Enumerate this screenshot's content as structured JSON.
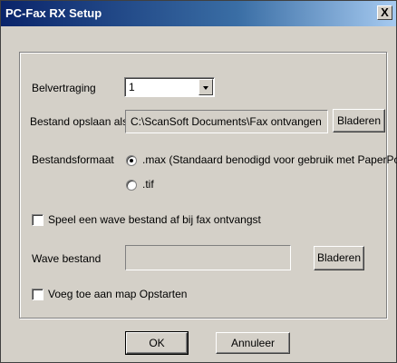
{
  "window": {
    "title": "PC-Fax RX Setup",
    "close_glyph": "X"
  },
  "belvertraging": {
    "label": "Belvertraging",
    "value": "1"
  },
  "bestand_opslaan": {
    "label": "Bestand opslaan als",
    "path": "C:\\ScanSoft Documents\\Fax ontvangen",
    "browse_label": "Bladeren"
  },
  "bestandsformaat": {
    "label": "Bestandsformaat",
    "options": [
      {
        "label": ".max (Standaard benodigd voor gebruik met PaperPort)",
        "selected": true
      },
      {
        "label": ".tif",
        "selected": false
      }
    ]
  },
  "wave_checkbox": {
    "label": "Speel een wave bestand af bij fax ontvangst",
    "checked": false
  },
  "wave_bestand": {
    "label": "Wave bestand",
    "path": "",
    "browse_label": "Bladeren"
  },
  "startup_checkbox": {
    "label": "Voeg toe aan map Opstarten",
    "checked": false
  },
  "buttons": {
    "ok": "OK",
    "cancel": "Annuleer"
  },
  "colors": {
    "dialog_bg": "#d4d0c8",
    "title_start": "#0a246a",
    "title_end": "#a6caf0"
  }
}
